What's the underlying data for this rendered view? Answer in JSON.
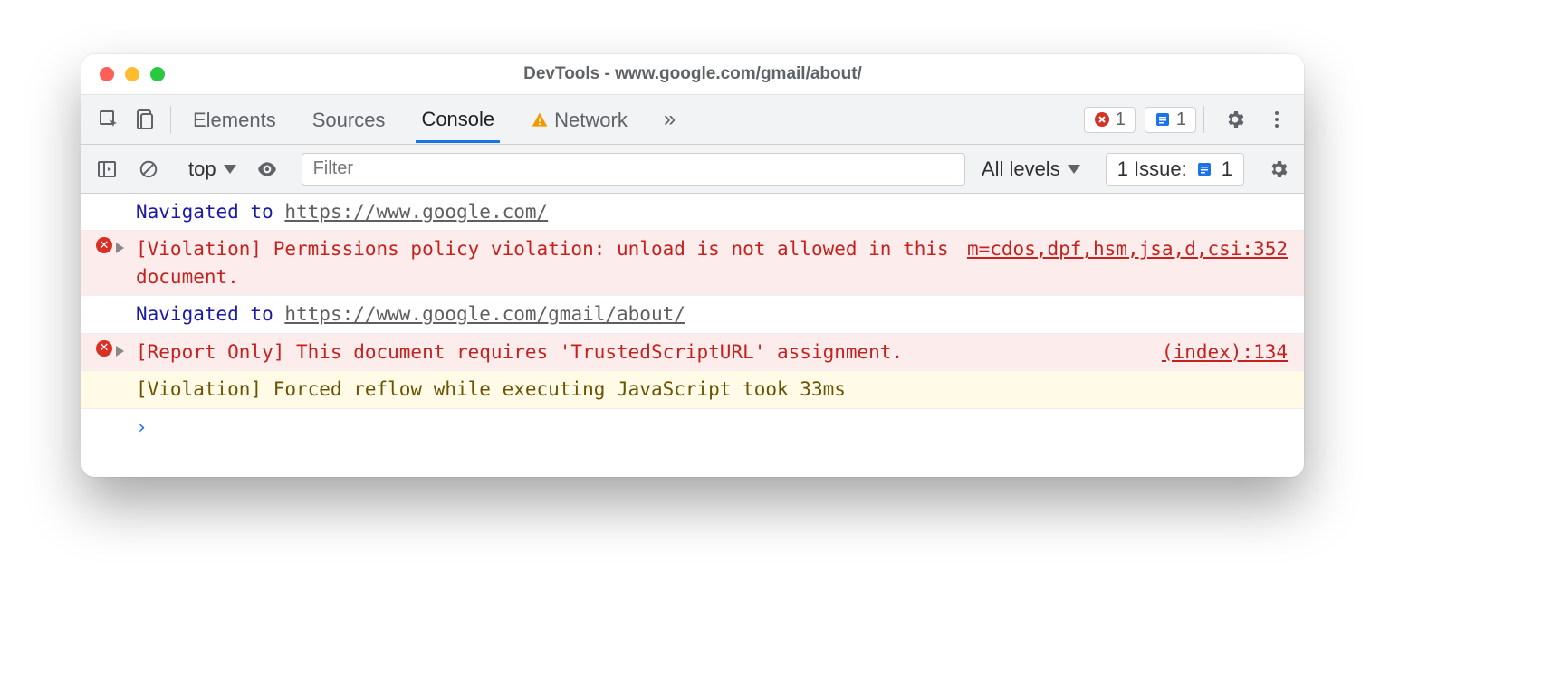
{
  "window": {
    "title": "DevTools - www.google.com/gmail/about/"
  },
  "tabs": {
    "elements": "Elements",
    "sources": "Sources",
    "console": "Console",
    "network": "Network"
  },
  "badges": {
    "error_count": "1",
    "issue_count": "1"
  },
  "filterbar": {
    "context": "top",
    "filter_placeholder": "Filter",
    "levels": "All levels",
    "issues_label": "1 Issue:",
    "issues_count": "1"
  },
  "logs": {
    "nav1_prefix": "Navigated to ",
    "nav1_url": "https://www.google.com/",
    "err1_msg": "[Violation] Permissions policy violation: unload is not allowed in this document.",
    "err1_src": "m=cdos,dpf,hsm,jsa,d,csi:352",
    "nav2_prefix": "Navigated to ",
    "nav2_url": "https://www.google.com/gmail/about/",
    "err2_msg": "[Report Only] This document requires 'TrustedScriptURL' assignment.",
    "err2_src": "(index):134",
    "warn_msg": "[Violation] Forced reflow while executing JavaScript took 33ms",
    "prompt": "›"
  }
}
